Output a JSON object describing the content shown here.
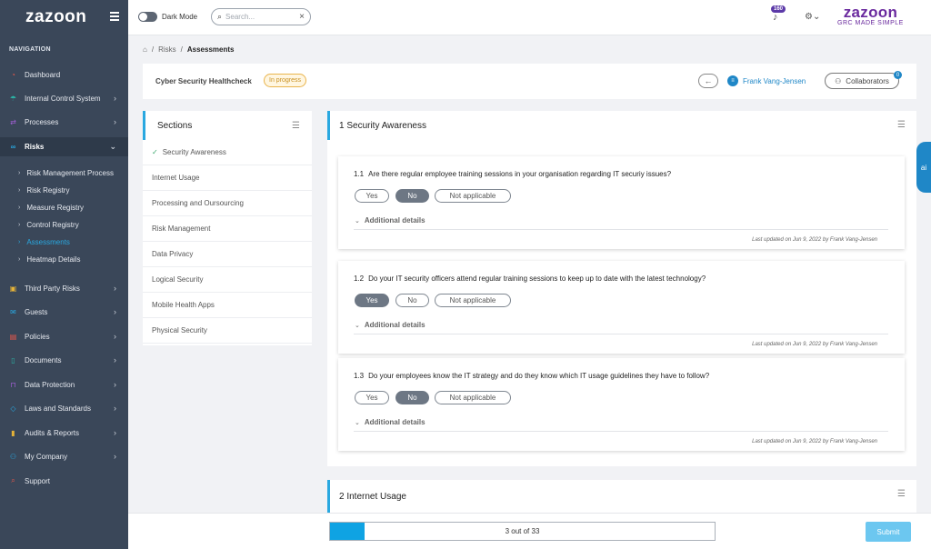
{
  "sidebar": {
    "logo": "zazoon",
    "nav_header": "NAVIGATION",
    "items": [
      {
        "label": "Dashboard",
        "icon": "dashboard-icon",
        "chevron": false
      },
      {
        "label": "Internal Control System",
        "icon": "ics-icon",
        "chevron": true
      },
      {
        "label": "Processes",
        "icon": "processes-icon",
        "chevron": true
      },
      {
        "label": "Risks",
        "icon": "risks-icon",
        "chevron": true,
        "active": true
      },
      {
        "label": "Third Party Risks",
        "icon": "box-icon",
        "chevron": true
      },
      {
        "label": "Guests",
        "icon": "mail-icon",
        "chevron": true
      },
      {
        "label": "Policies",
        "icon": "document-icon",
        "chevron": true
      },
      {
        "label": "Documents",
        "icon": "file-icon",
        "chevron": true
      },
      {
        "label": "Data Protection",
        "icon": "lock-icon",
        "chevron": true
      },
      {
        "label": "Laws and Standards",
        "icon": "shield-icon",
        "chevron": true
      },
      {
        "label": "Audits & Reports",
        "icon": "bar-chart-icon",
        "chevron": true
      },
      {
        "label": "My Company",
        "icon": "users-icon",
        "chevron": true
      },
      {
        "label": "Support",
        "icon": "search-icon",
        "chevron": false
      }
    ],
    "sub_items": [
      "Risk Management Process",
      "Risk Registry",
      "Measure Registry",
      "Control Registry",
      "Assessments",
      "Heatmap Details"
    ]
  },
  "topbar": {
    "dark_mode_label": "Dark Mode",
    "search_placeholder": "Search...",
    "notification_count": "160",
    "brand_name": "zazoon",
    "brand_tagline": "GRC MADE SIMPLE"
  },
  "breadcrumb": {
    "items": [
      "Risks",
      "Assessments"
    ]
  },
  "header": {
    "title": "Cyber Security Healthcheck",
    "status": "In progress",
    "owner": "Frank Vang-Jensen",
    "collaborators_label": "Collaborators",
    "collaborators_count": "0"
  },
  "sections": {
    "title": "Sections",
    "items": [
      "Security Awareness",
      "Internet Usage",
      "Processing and Oursourcing",
      "Risk Management",
      "Data Privacy",
      "Logical Security",
      "Mobile Health Apps",
      "Physical Security"
    ]
  },
  "main": {
    "section_title": "1 Security Awareness",
    "answers": [
      "Yes",
      "No",
      "Not applicable"
    ],
    "additional_details": "Additional details",
    "questions": [
      {
        "num": "1.1",
        "text": "Are there regular employee training sessions in your organisation regarding IT securiy issues?",
        "selected": "No",
        "updated": "Last updated on Jun 9, 2022 by Frank Vang-Jensen"
      },
      {
        "num": "1.2",
        "text": "Do your IT security officers attend regular training sessions to keep up to date with the latest technology?",
        "selected": "Yes",
        "updated": "Last updated on Jun 9, 2022 by Frank Vang-Jensen"
      },
      {
        "num": "1.3",
        "text": "Do your employees know the IT strategy and do they know which IT usage guidelines they have to follow?",
        "selected": "No",
        "updated": "Last updated on Jun 9, 2022 by Frank Vang-Jensen"
      }
    ],
    "next_section_title": "2 Internet Usage"
  },
  "footer": {
    "progress_text": "3 out of 33",
    "progress_fraction": 0.0909,
    "submit_label": "Submit"
  },
  "ai_tab": "ai",
  "colors": {
    "accent": "#29a8e0",
    "sidebar": "#3a4759",
    "brand": "#6a2a9e",
    "progress": "#0fa3e3"
  }
}
